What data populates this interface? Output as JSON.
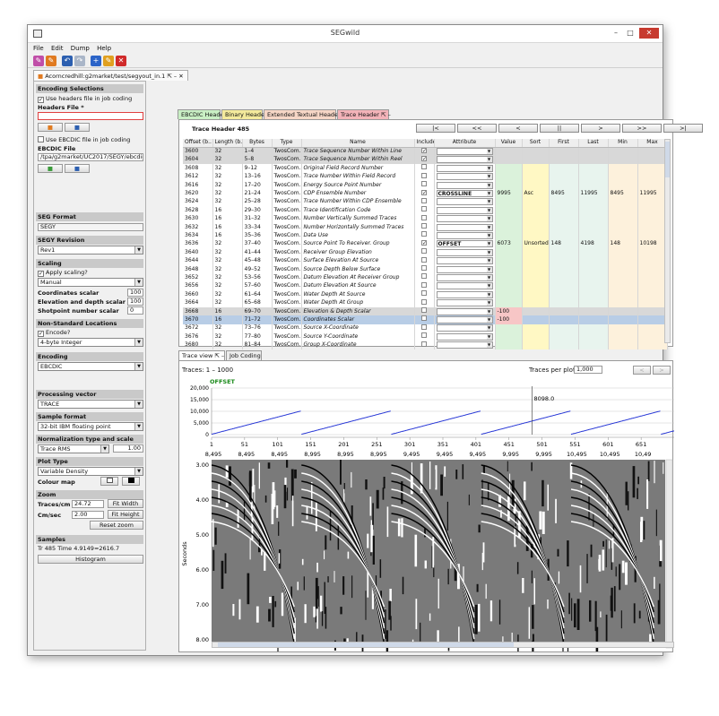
{
  "window": {
    "title": "SEGwild"
  },
  "menu": [
    "File",
    "Edit",
    "Dump",
    "Help"
  ],
  "doc_tab": {
    "label": "Acorncredhill:g2market/test/segyout_in.1"
  },
  "left": {
    "encoding_selections": "Encoding Selections",
    "use_headers_file": "Use headers file in job coding",
    "headers_file_label": "Headers File *",
    "headers_file_value": "",
    "use_ebcdic_file": "Use EBCDIC file in job coding",
    "ebcdic_file_label": "EBCDIC File",
    "ebcdic_file_value": "/tpa/g2market/UC2017/SEGY/ebcdic1",
    "seg_format": "SEG Format",
    "seg_format_value": "SEGY",
    "segy_revision": "SEGY Revision",
    "segy_revision_value": "Rev1",
    "scaling": "Scaling",
    "apply_scaling": "Apply scaling?",
    "scaling_mode": "Manual",
    "coord_scalar_label": "Coordinates scalar",
    "coord_scalar_value": "100",
    "elev_scalar_label": "Elevation and depth scalar",
    "elev_scalar_value": "100",
    "shotpoint_scalar_label": "Shotpoint number scalar",
    "shotpoint_scalar_value": "0",
    "non_standard": "Non-Standard Locations",
    "encode": "Encode?",
    "int_type": "4-byte Integer",
    "encoding": "Encoding",
    "encoding_value": "EBCDIC",
    "processing_vector": "Processing vector",
    "processing_vector_value": "TRACE",
    "sample_format": "Sample format",
    "sample_format_value": "32-bit IBM floating point",
    "normalization": "Normalization type and scale",
    "normalization_value": "Trace RMS",
    "normalization_scale": "1.00",
    "plot_type": "Plot Type",
    "plot_type_value": "Variable Density",
    "colour_map": "Colour map",
    "zoom": "Zoom",
    "traces_cm_label": "Traces/cm",
    "traces_cm_value": "24.72",
    "fit_width": "Fit Width",
    "cm_sec_label": "Cm/sec",
    "cm_sec_value": "2.00",
    "fit_height": "Fit Height",
    "reset_zoom": "Reset zoom",
    "samples": "Samples",
    "samples_value": "Tr 485  Time 4.9149=2616.7",
    "histogram": "Histogram"
  },
  "header_tabs": [
    "EBCDIC Header",
    "Binary Header",
    "Extended Textual Header",
    "Trace Header"
  ],
  "trace_header": {
    "title": "Trace Header 485",
    "nav": [
      "|<",
      "<<",
      "<",
      "||",
      ">",
      ">>",
      ">|"
    ],
    "columns": [
      "Offset (b..",
      "Length (b..",
      "Bytes",
      "Type",
      "Name",
      "Include?",
      "Attribute",
      "Value",
      "Sort",
      "First",
      "Last",
      "Min",
      "Max"
    ],
    "rows": [
      [
        "3600",
        "32",
        "1–4",
        "TwosCom...",
        "Trace Sequence Number Within Line",
        "",
        "",
        "",
        "",
        "",
        "",
        "",
        ""
      ],
      [
        "3604",
        "32",
        "5–8",
        "TwosCom...",
        "Trace Sequence Number Within Reel",
        "",
        "",
        "",
        "",
        "",
        "",
        "",
        ""
      ],
      [
        "3608",
        "32",
        "9–12",
        "TwosCom...",
        "Original Field Record Number",
        "",
        "",
        "",
        "",
        "",
        "",
        "",
        ""
      ],
      [
        "3612",
        "32",
        "13–16",
        "TwosCom...",
        "Trace Number Within Field Record",
        "",
        "",
        "",
        "",
        "",
        "",
        "",
        ""
      ],
      [
        "3616",
        "32",
        "17–20",
        "TwosCom...",
        "Energy Source Point Number",
        "",
        "",
        "",
        "",
        "",
        "",
        "",
        ""
      ],
      [
        "3620",
        "32",
        "21–24",
        "TwosCom...",
        "CDP Ensemble Number",
        "",
        "CROSSLINE",
        "9995",
        "Asc",
        "8495",
        "11995",
        "8495",
        "11995"
      ],
      [
        "3624",
        "32",
        "25–28",
        "TwosCom...",
        "Trace Number Within CDP Ensemble",
        "",
        "",
        "",
        "",
        "",
        "",
        "",
        ""
      ],
      [
        "3628",
        "16",
        "29–30",
        "TwosCom...",
        "Trace Identification Code",
        "",
        "",
        "",
        "",
        "",
        "",
        "",
        ""
      ],
      [
        "3630",
        "16",
        "31–32",
        "TwosCom...",
        "Number Vertically Summed Traces",
        "",
        "",
        "",
        "",
        "",
        "",
        "",
        ""
      ],
      [
        "3632",
        "16",
        "33–34",
        "TwosCom...",
        "Number Horizontally Summed Traces",
        "",
        "",
        "",
        "",
        "",
        "",
        "",
        ""
      ],
      [
        "3634",
        "16",
        "35–36",
        "TwosCom...",
        "Data Use",
        "",
        "",
        "",
        "",
        "",
        "",
        "",
        ""
      ],
      [
        "3636",
        "32",
        "37–40",
        "TwosCom...",
        "Source Point To Receiver. Group",
        "",
        "OFFSET",
        "6073",
        "Unsorted",
        "148",
        "4198",
        "148",
        "10198"
      ],
      [
        "3640",
        "32",
        "41–44",
        "TwosCom...",
        "Receiver Group Elevation",
        "",
        "",
        "",
        "",
        "",
        "",
        "",
        ""
      ],
      [
        "3644",
        "32",
        "45–48",
        "TwosCom...",
        "Surface Elevation At Source",
        "",
        "",
        "",
        "",
        "",
        "",
        "",
        ""
      ],
      [
        "3648",
        "32",
        "49–52",
        "TwosCom...",
        "Source Depth Below Surface",
        "",
        "",
        "",
        "",
        "",
        "",
        "",
        ""
      ],
      [
        "3652",
        "32",
        "53–56",
        "TwosCom...",
        "Datum Elevation At Receiver Group",
        "",
        "",
        "",
        "",
        "",
        "",
        "",
        ""
      ],
      [
        "3656",
        "32",
        "57–60",
        "TwosCom...",
        "Datum Elevation At Source",
        "",
        "",
        "",
        "",
        "",
        "",
        "",
        ""
      ],
      [
        "3660",
        "32",
        "61–64",
        "TwosCom...",
        "Water Depth At Source",
        "",
        "",
        "",
        "",
        "",
        "",
        "",
        ""
      ],
      [
        "3664",
        "32",
        "65–68",
        "TwosCom...",
        "Water Depth At Group",
        "",
        "",
        "",
        "",
        "",
        "",
        "",
        ""
      ],
      [
        "3668",
        "16",
        "69–70",
        "TwosCom...",
        "Elevation & Depth Scalar",
        "",
        "",
        "-100",
        "",
        "",
        "",
        "",
        ""
      ],
      [
        "3670",
        "16",
        "71–72",
        "TwosCom...",
        "Coordinates Scalar",
        "",
        "",
        "-100",
        "",
        "",
        "",
        "",
        ""
      ],
      [
        "3672",
        "32",
        "73–76",
        "TwosCom...",
        "Source X-Coordinate",
        "",
        "",
        "",
        "",
        "",
        "",
        "",
        ""
      ],
      [
        "3676",
        "32",
        "77–80",
        "TwosCom...",
        "Source Y-Coordinate",
        "",
        "",
        "",
        "",
        "",
        "",
        "",
        ""
      ],
      [
        "3680",
        "32",
        "81–84",
        "TwosCom...",
        "Group X-Coordinate",
        "",
        "",
        "",
        "",
        "",
        "",
        "",
        ""
      ]
    ]
  },
  "view_tabs": [
    "Trace view",
    "Job Coding"
  ],
  "trace_view": {
    "traces_label": "Traces: 1 – 1000",
    "per_plot_label": "Traces per plot:",
    "per_plot_value": "1,000",
    "prev": "<",
    "next": ">",
    "attribute_label": "OFFSET",
    "cursor_value": "8098.0",
    "seconds_label": "Seconds"
  },
  "chart_data": {
    "type": "line",
    "series": [
      {
        "name": "OFFSET",
        "values": []
      }
    ],
    "y_ticks": [
      "20,000",
      "15,000",
      "10,000",
      "5,000",
      "0"
    ],
    "ylim": [
      0,
      20000
    ],
    "x_ticks_trace": [
      "1",
      "51",
      "101",
      "151",
      "201",
      "251",
      "301",
      "351",
      "401",
      "451",
      "501",
      "551",
      "601",
      "651"
    ],
    "x_ticks_crossline": [
      "8,495",
      "8,495",
      "8,495",
      "8,995",
      "8,995",
      "8,995",
      "9,495",
      "9,495",
      "9,495",
      "9,995",
      "9,995",
      "10,495",
      "10,495",
      "10,49"
    ],
    "time_ticks": [
      "3.00",
      "4.00",
      "5.00",
      "6.00",
      "7.00",
      "8.00"
    ],
    "sawtooth": {
      "period_traces": 136,
      "min": 148,
      "max": 10198,
      "traces": 700
    }
  },
  "colors": {
    "accent_tab": "#f3b3b9",
    "selected_row": "#b8cde6",
    "line": "#2535d6"
  }
}
